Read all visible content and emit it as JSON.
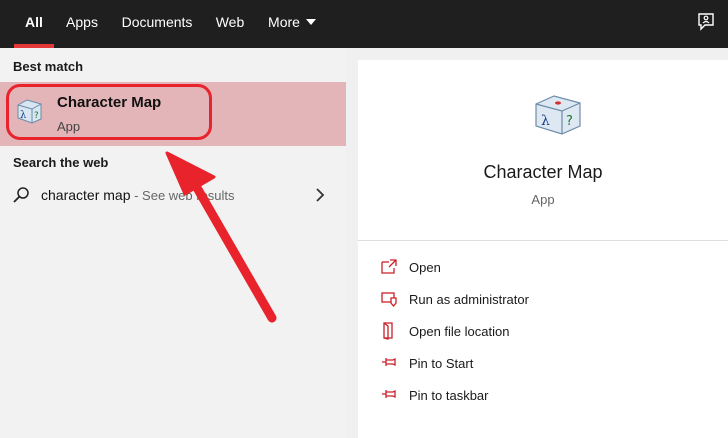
{
  "tabs": [
    {
      "label": "All",
      "active": true
    },
    {
      "label": "Apps"
    },
    {
      "label": "Documents"
    },
    {
      "label": "Web"
    },
    {
      "label": "More"
    }
  ],
  "topbar": {
    "feedback_icon": "feedback-icon"
  },
  "left": {
    "best_match_heading": "Best match",
    "best_match": {
      "title": "Character Map",
      "subtitle": "App",
      "icon": "character-map-icon"
    },
    "search_web_heading": "Search the web",
    "web_query": "character map",
    "web_suffix": " - See web results"
  },
  "right": {
    "title": "Character Map",
    "subtitle": "App",
    "actions": [
      {
        "label": "Open",
        "icon": "open-icon"
      },
      {
        "label": "Run as administrator",
        "icon": "shield-icon"
      },
      {
        "label": "Open file location",
        "icon": "file-location-icon"
      },
      {
        "label": "Pin to Start",
        "icon": "pin-icon"
      },
      {
        "label": "Pin to taskbar",
        "icon": "pin-icon"
      }
    ]
  },
  "colors": {
    "accent": "#e23838",
    "selection": "#e3b4b8",
    "annotation": "#e8232b"
  }
}
